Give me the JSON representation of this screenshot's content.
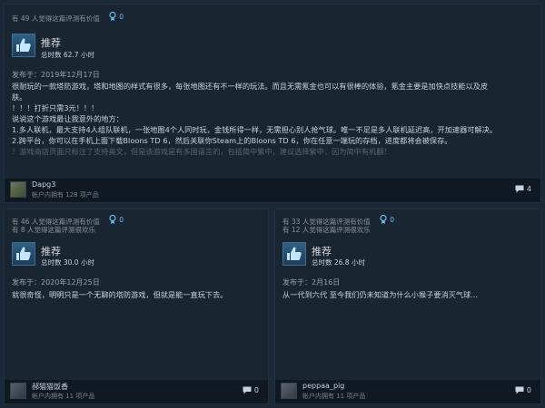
{
  "reviews": [
    {
      "helpful_line": "有 49 人觉得这篇评测有价值",
      "award_count": "0",
      "recommendation": "推荐",
      "hours": "总时数 62.7 小时",
      "posted": "发布于：2019年12月17日",
      "body_lines": [
        "很耐玩的一款塔防游戏，塔和地图的样式有很多，每张地图还有不一样的玩法。而且无需氪金也可以有很棒的体验，氪金主要是加快点技能以及皮",
        "肤。",
        "！！！打折只需3元！！！",
        "说说这个游戏最让我意外的地方：",
        "1.多人联机，最大支持4人组队联机，一张地图4个人同时玩，金钱所得一样，无需担心别人抢气球。唯一不足是多人联机延迟高，开加速器可解决。",
        "2.跨平台，你可以在手机上面下载Bloons TD 6，然后关联你Steam上的Bloons TD 6，你在任意一端玩的存档，进度都将会被保存。",
        "！游戏商店页面只标注了支持英文，但是该游戏是有多国语言的，包括简中繁中，建议选择繁中，因为简中有机翻！"
      ],
      "username": "Dapg3",
      "products": "帐户内拥有 128 项产品",
      "comment_count": "4",
      "avatar_color": "#4a5a40"
    },
    {
      "helpful_line": "有 46 人觉得这篇评测有价值",
      "funny_line": "有 8 人觉得这篇评测很欢乐",
      "award_count": "0",
      "recommendation": "推荐",
      "hours": "总时数 30.0 小时",
      "posted": "发布于：2020年12月25日",
      "body_lines": [
        "就很奇怪，明明只是一个无聊的塔防游戏，但就是能一直玩下去。"
      ],
      "username": "郝猫猫饭香",
      "products": "帐户内拥有 11 项产品",
      "comment_count": "0",
      "avatar_color": "#3a4550"
    },
    {
      "helpful_line": "有 33 人觉得这篇评测有价值",
      "funny_line": "有 12 人觉得这篇评测很欢乐",
      "award_count": "0",
      "recommendation": "推荐",
      "hours": "总时数 26.8 小时",
      "posted": "发布于：2月16日",
      "body_lines": [
        "从一代到六代 至今我们仍未知道为什么小猴子要消灭气球..."
      ],
      "username": "peppaa_pig",
      "products": "帐户内拥有 11 项产品",
      "comment_count": "0",
      "avatar_color": "#4a4f58"
    }
  ]
}
